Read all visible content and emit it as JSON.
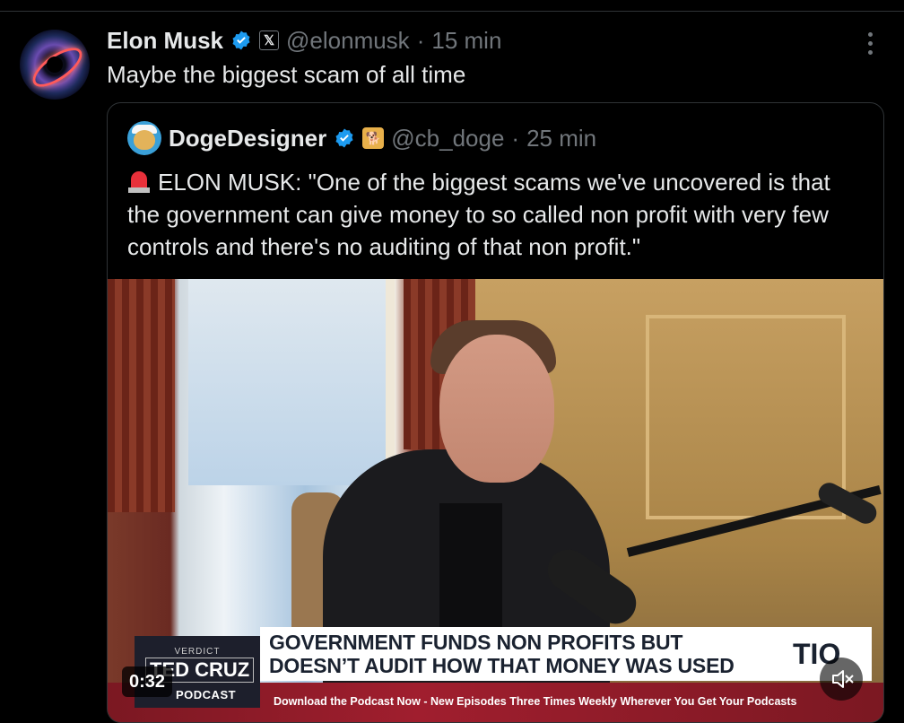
{
  "tweet": {
    "author": {
      "name": "Elon Musk",
      "handle": "@elonmusk"
    },
    "separator": "·",
    "time": "15 min",
    "text": "Maybe the biggest scam of all time"
  },
  "quoted": {
    "author": {
      "name": "DogeDesigner",
      "handle": "@cb_doge"
    },
    "separator": "·",
    "time": "25 min",
    "text": "ELON MUSK: \"One of the biggest scams we've uncovered is that the government can give money to so called non profit with very few controls and there's no auditing of that non profit.\""
  },
  "video": {
    "duration": "0:32",
    "banner_line1": "GOVERNMENT FUNDS NON PROFITS BUT",
    "banner_line2": "DOESN’T AUDIT HOW THAT MONEY WAS USED",
    "banner_tail": "TIO",
    "logo_top": "VERDICT",
    "logo_main": "TED CRUZ",
    "logo_sub": "PODCAST",
    "ticker": "Download the Podcast Now - New Episodes Three Times Weekly Wherever You Get Your Podcasts"
  },
  "icons": {
    "verified": "verified-badge-icon",
    "x_affiliation": "x-logo-icon",
    "more": "more-options-icon",
    "siren": "siren-emoji-icon",
    "mute": "volume-muted-icon"
  },
  "colors": {
    "verified": "#1d9bf0",
    "muted_text": "#71767b",
    "background": "#000000"
  }
}
